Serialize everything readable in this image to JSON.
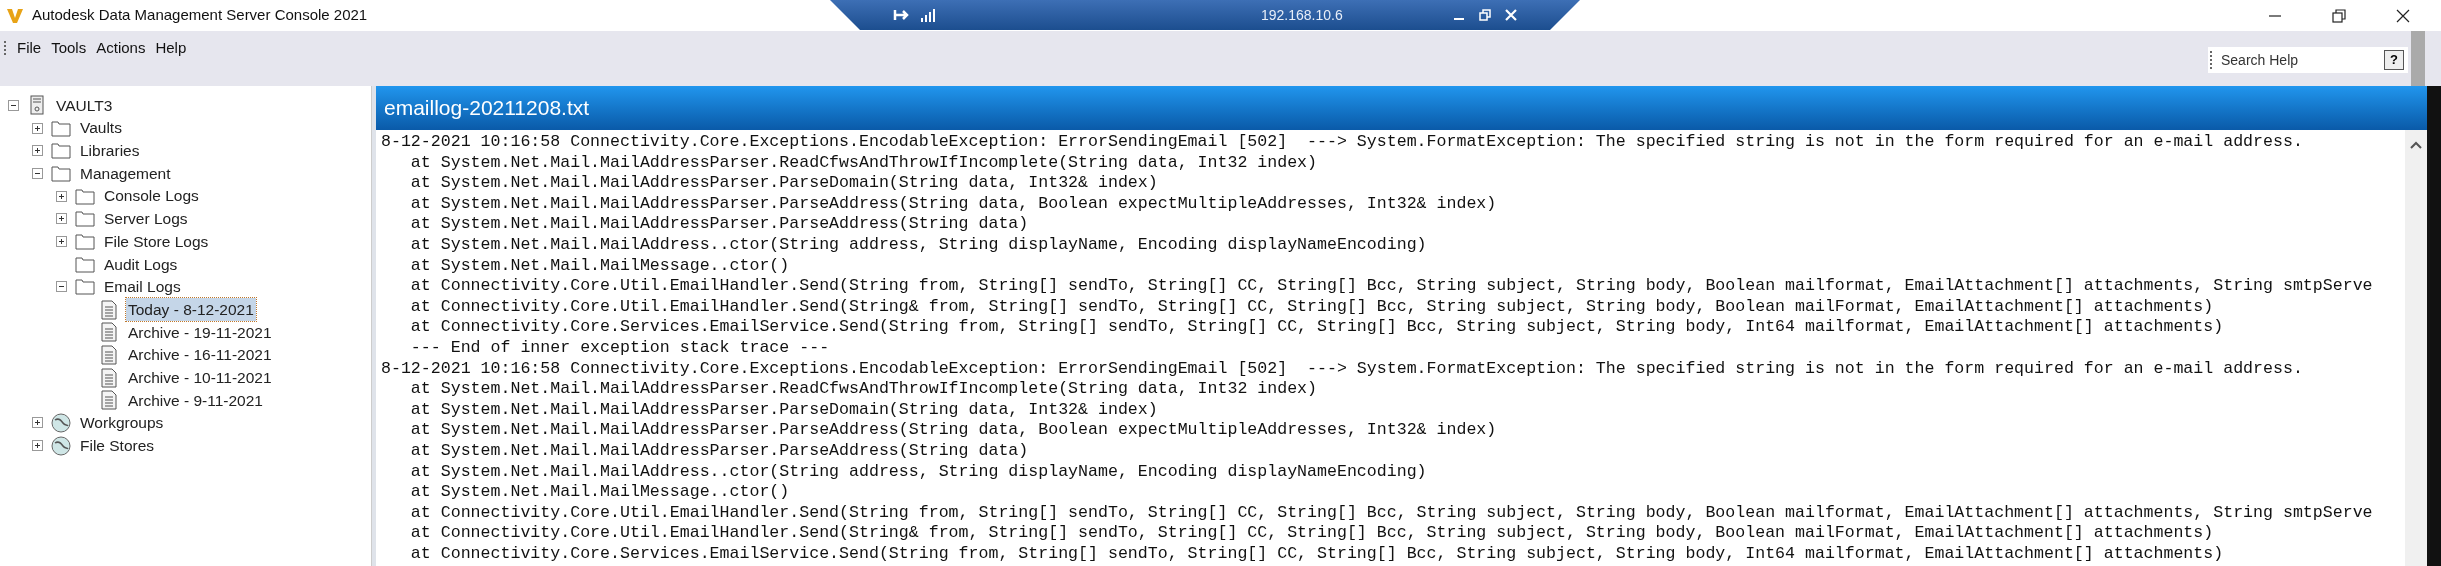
{
  "window": {
    "title": "Autodesk Data Management Server Console 2021"
  },
  "remote_bar": {
    "host": "192.168.10.6"
  },
  "menu": [
    "File",
    "Tools",
    "Actions",
    "Help"
  ],
  "search": {
    "placeholder": "Search Help",
    "help": "?"
  },
  "tree": [
    {
      "label": "VAULT3",
      "kind": "server",
      "expanded": true,
      "children": [
        {
          "label": "Vaults",
          "kind": "folder",
          "expanded": false
        },
        {
          "label": "Libraries",
          "kind": "folder",
          "expanded": false
        },
        {
          "label": "Management",
          "kind": "folder",
          "expanded": true,
          "children": [
            {
              "label": "Console Logs",
              "kind": "folder",
              "expanded": false
            },
            {
              "label": "Server Logs",
              "kind": "folder",
              "expanded": false
            },
            {
              "label": "File Store Logs",
              "kind": "folder",
              "expanded": false
            },
            {
              "label": "Audit Logs",
              "kind": "folder"
            },
            {
              "label": "Email Logs",
              "kind": "folder",
              "expanded": true,
              "children": [
                {
                  "label": "Today - 8-12-2021",
                  "kind": "document",
                  "selected": true
                },
                {
                  "label": "Archive - 19-11-2021",
                  "kind": "document",
                  "selected": false
                },
                {
                  "label": "Archive - 16-11-2021",
                  "kind": "document",
                  "selected": false
                },
                {
                  "label": "Archive - 10-11-2021",
                  "kind": "document",
                  "selected": false
                },
                {
                  "label": "Archive - 9-11-2021",
                  "kind": "document",
                  "selected": false
                }
              ]
            }
          ]
        },
        {
          "label": "Workgroups",
          "kind": "globe",
          "expanded": false
        },
        {
          "label": "File Stores",
          "kind": "globe",
          "expanded": false
        }
      ]
    }
  ],
  "log": {
    "title": "emaillog-20211208.txt",
    "lines": [
      "8-12-2021 10:16:58 Connectivity.Core.Exceptions.EncodableException: ErrorSendingEmail [502]  ---> System.FormatException: The specified string is not in the form required for an e-mail address.",
      "   at System.Net.Mail.MailAddressParser.ReadCfwsAndThrowIfIncomplete(String data, Int32 index)",
      "   at System.Net.Mail.MailAddressParser.ParseDomain(String data, Int32& index)",
      "   at System.Net.Mail.MailAddressParser.ParseAddress(String data, Boolean expectMultipleAddresses, Int32& index)",
      "   at System.Net.Mail.MailAddressParser.ParseAddress(String data)",
      "   at System.Net.Mail.MailAddress..ctor(String address, String displayName, Encoding displayNameEncoding)",
      "   at System.Net.Mail.MailMessage..ctor()",
      "   at Connectivity.Core.Util.EmailHandler.Send(String from, String[] sendTo, String[] CC, String[] Bcc, String subject, String body, Boolean mailformat, EmailAttachment[] attachments, String smtpServe",
      "   at Connectivity.Core.Util.EmailHandler.Send(String& from, String[] sendTo, String[] CC, String[] Bcc, String subject, String body, Boolean mailFormat, EmailAttachment[] attachments)",
      "   at Connectivity.Core.Services.EmailService.Send(String from, String[] sendTo, String[] CC, String[] Bcc, String subject, String body, Int64 mailformat, EmailAttachment[] attachments)",
      "   --- End of inner exception stack trace ---",
      "8-12-2021 10:16:58 Connectivity.Core.Exceptions.EncodableException: ErrorSendingEmail [502]  ---> System.FormatException: The specified string is not in the form required for an e-mail address.",
      "   at System.Net.Mail.MailAddressParser.ReadCfwsAndThrowIfIncomplete(String data, Int32 index)",
      "   at System.Net.Mail.MailAddressParser.ParseDomain(String data, Int32& index)",
      "   at System.Net.Mail.MailAddressParser.ParseAddress(String data, Boolean expectMultipleAddresses, Int32& index)",
      "   at System.Net.Mail.MailAddressParser.ParseAddress(String data)",
      "   at System.Net.Mail.MailAddress..ctor(String address, String displayName, Encoding displayNameEncoding)",
      "   at System.Net.Mail.MailMessage..ctor()",
      "   at Connectivity.Core.Util.EmailHandler.Send(String from, String[] sendTo, String[] CC, String[] Bcc, String subject, String body, Boolean mailformat, EmailAttachment[] attachments, String smtpServe",
      "   at Connectivity.Core.Util.EmailHandler.Send(String& from, String[] sendTo, String[] CC, String[] Bcc, String subject, String body, Boolean mailFormat, EmailAttachment[] attachments)",
      "   at Connectivity.Core.Services.EmailService.Send(String from, String[] sendTo, String[] CC, String[] Bcc, String subject, String body, Int64 mailformat, EmailAttachment[] attachments)"
    ]
  }
}
